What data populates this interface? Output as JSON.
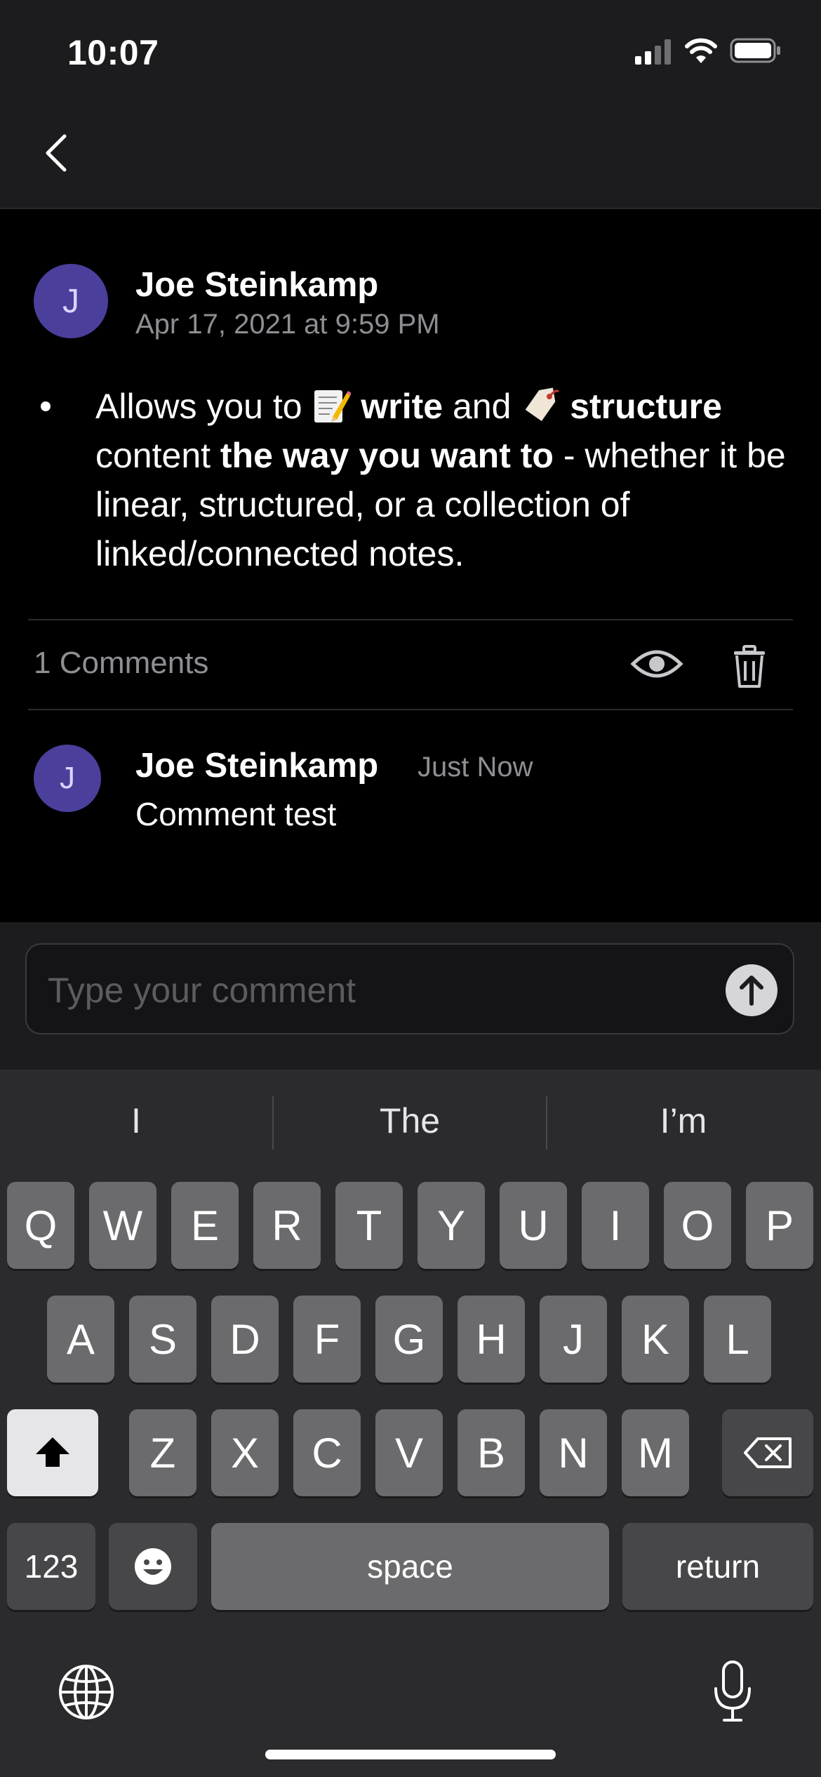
{
  "status_bar": {
    "time": "10:07"
  },
  "post": {
    "author_initial": "J",
    "author_first": "Joe",
    "author_last": "Steinkamp",
    "date": "Apr 17, 2021 at 9:59 PM",
    "body": {
      "t1": "Allows you to ",
      "t2": "write",
      "t3": " and ",
      "t4": "structure",
      "t5": " content ",
      "t6": "the way you want to",
      "t7": " - whether it be linear, structured, or a collection of linked/connected notes."
    }
  },
  "comments": {
    "count_label": "1 Comments",
    "items": [
      {
        "initial": "J",
        "first": "Joe",
        "last": "Steinkamp",
        "time": "Just Now",
        "text": "Comment test"
      }
    ]
  },
  "composer": {
    "placeholder": "Type your comment"
  },
  "keyboard": {
    "suggestions": [
      "I",
      "The",
      "I’m"
    ],
    "row1": [
      "Q",
      "W",
      "E",
      "R",
      "T",
      "Y",
      "U",
      "I",
      "O",
      "P"
    ],
    "row2": [
      "A",
      "S",
      "D",
      "F",
      "G",
      "H",
      "J",
      "K",
      "L"
    ],
    "row3": [
      "Z",
      "X",
      "C",
      "V",
      "B",
      "N",
      "M"
    ],
    "numbers_label": "123",
    "space_label": "space",
    "return_label": "return"
  },
  "colors": {
    "avatar": "#4b3f9c",
    "background": "#000000",
    "header": "#1c1c1e"
  }
}
